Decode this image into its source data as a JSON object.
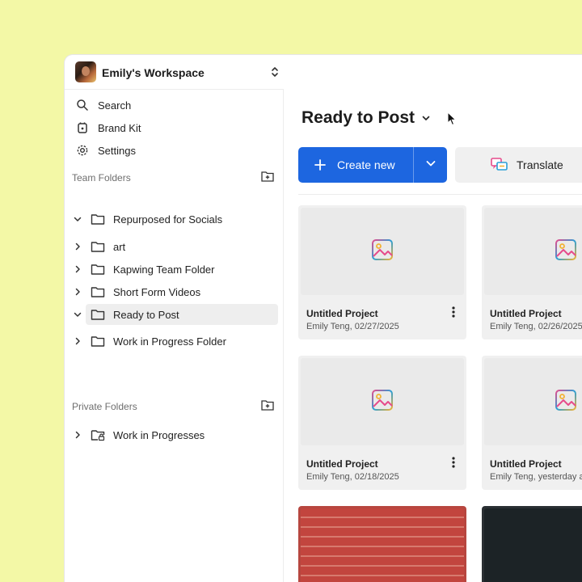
{
  "workspace": {
    "name": "Emily's Workspace"
  },
  "nav": [
    {
      "label": "Search",
      "icon": "search-icon"
    },
    {
      "label": "Brand Kit",
      "icon": "brand-kit-icon"
    },
    {
      "label": "Settings",
      "icon": "gear-icon"
    }
  ],
  "team_folders": {
    "label": "Team Folders",
    "items": [
      {
        "label": "Repurposed for Socials",
        "expanded": true
      },
      {
        "label": "art",
        "expanded": false
      },
      {
        "label": "Kapwing Team Folder",
        "expanded": false
      },
      {
        "label": "Short Form Videos",
        "expanded": false
      },
      {
        "label": "Ready to Post",
        "expanded": true,
        "active": true
      },
      {
        "label": "Work in Progress Folder",
        "expanded": false
      }
    ]
  },
  "private_folders": {
    "label": "Private Folders",
    "items": [
      {
        "label": "Work in Progresses",
        "expanded": false,
        "locked": true
      }
    ]
  },
  "main": {
    "title": "Ready to Post",
    "create_label": "Create new",
    "translate_label": "Translate",
    "accent": "#1d66e0",
    "projects": [
      {
        "title": "Untitled Project",
        "meta": "Emily Teng, 02/27/2025"
      },
      {
        "title": "Untitled Project",
        "meta": "Emily Teng, 02/26/2025"
      },
      {
        "title": "Untitled Project",
        "meta": "Emily Teng, 02/18/2025"
      },
      {
        "title": "Untitled Project",
        "meta": "Emily Teng, yesterday a"
      }
    ]
  }
}
